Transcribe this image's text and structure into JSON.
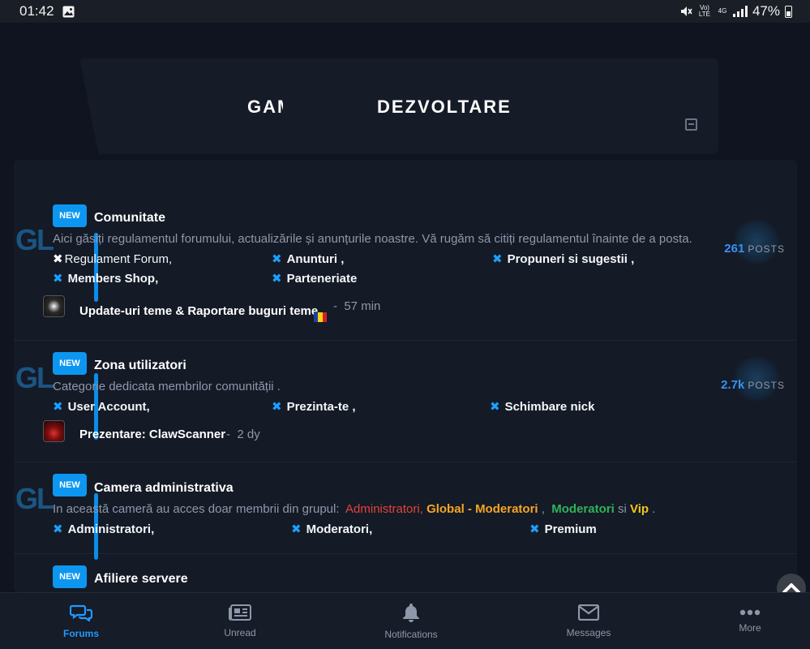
{
  "status_bar": {
    "time": "01:42",
    "volte": "Vo) LTE",
    "network": "4G",
    "battery": "47%"
  },
  "header": {
    "title_left": "GAMING",
    "title_right": "DEZVOLTARE"
  },
  "nodes": [
    {
      "badge": "NEW",
      "logo": "GL",
      "title": "Comunitate",
      "description": "Aici găsiți regulamentul forumului, actualizările și anunțurile noastre. Vă rugăm să citiți regulamentul înainte de a posta.",
      "subforums": [
        "Regulament Forum,",
        "Anunturi ,",
        "Propuneri si sugestii ,",
        "Members Shop,",
        "Parteneriate"
      ],
      "last_post_title": "Update-uri teme & Raportare buguri teme",
      "last_post_time": "57 min",
      "stats_num": "261",
      "stats_label": "POSTS"
    },
    {
      "badge": "NEW",
      "logo": "GL",
      "title": "Zona utilizatori",
      "description": "Categorie dedicata membrilor comunității .",
      "subforums": [
        "User Account,",
        "Prezinta-te ,",
        "Schimbare nick"
      ],
      "last_post_title": "Prezentare: ClawScanner",
      "last_post_time": "2 dy",
      "stats_num": "2.7k",
      "stats_label": "POSTS"
    },
    {
      "badge": "NEW",
      "logo": "GL",
      "title": "Camera administrativa",
      "description_prefix": "In această cameră au acces doar membrii din grupul:",
      "roles": {
        "admins": "Administratori,",
        "global_mods": "Global - Moderatori",
        "comma": ",",
        "mods": "Moderatori",
        "and": "si",
        "vip": "Vip",
        "end": "."
      },
      "subforums": [
        "Administratori,",
        "Moderatori,",
        "Premium"
      ]
    },
    {
      "badge": "NEW",
      "title": "Afiliere servere"
    }
  ],
  "separator": "-",
  "bottom_nav": {
    "forums": "Forums",
    "unread": "Unread",
    "notifications": "Notifications",
    "messages": "Messages",
    "more": "More"
  },
  "colors": {
    "accent": "#0d96f0",
    "admin": "#e0443b",
    "global_mod": "#f5a623",
    "mod": "#2fb35a",
    "vip": "#f5c518"
  }
}
